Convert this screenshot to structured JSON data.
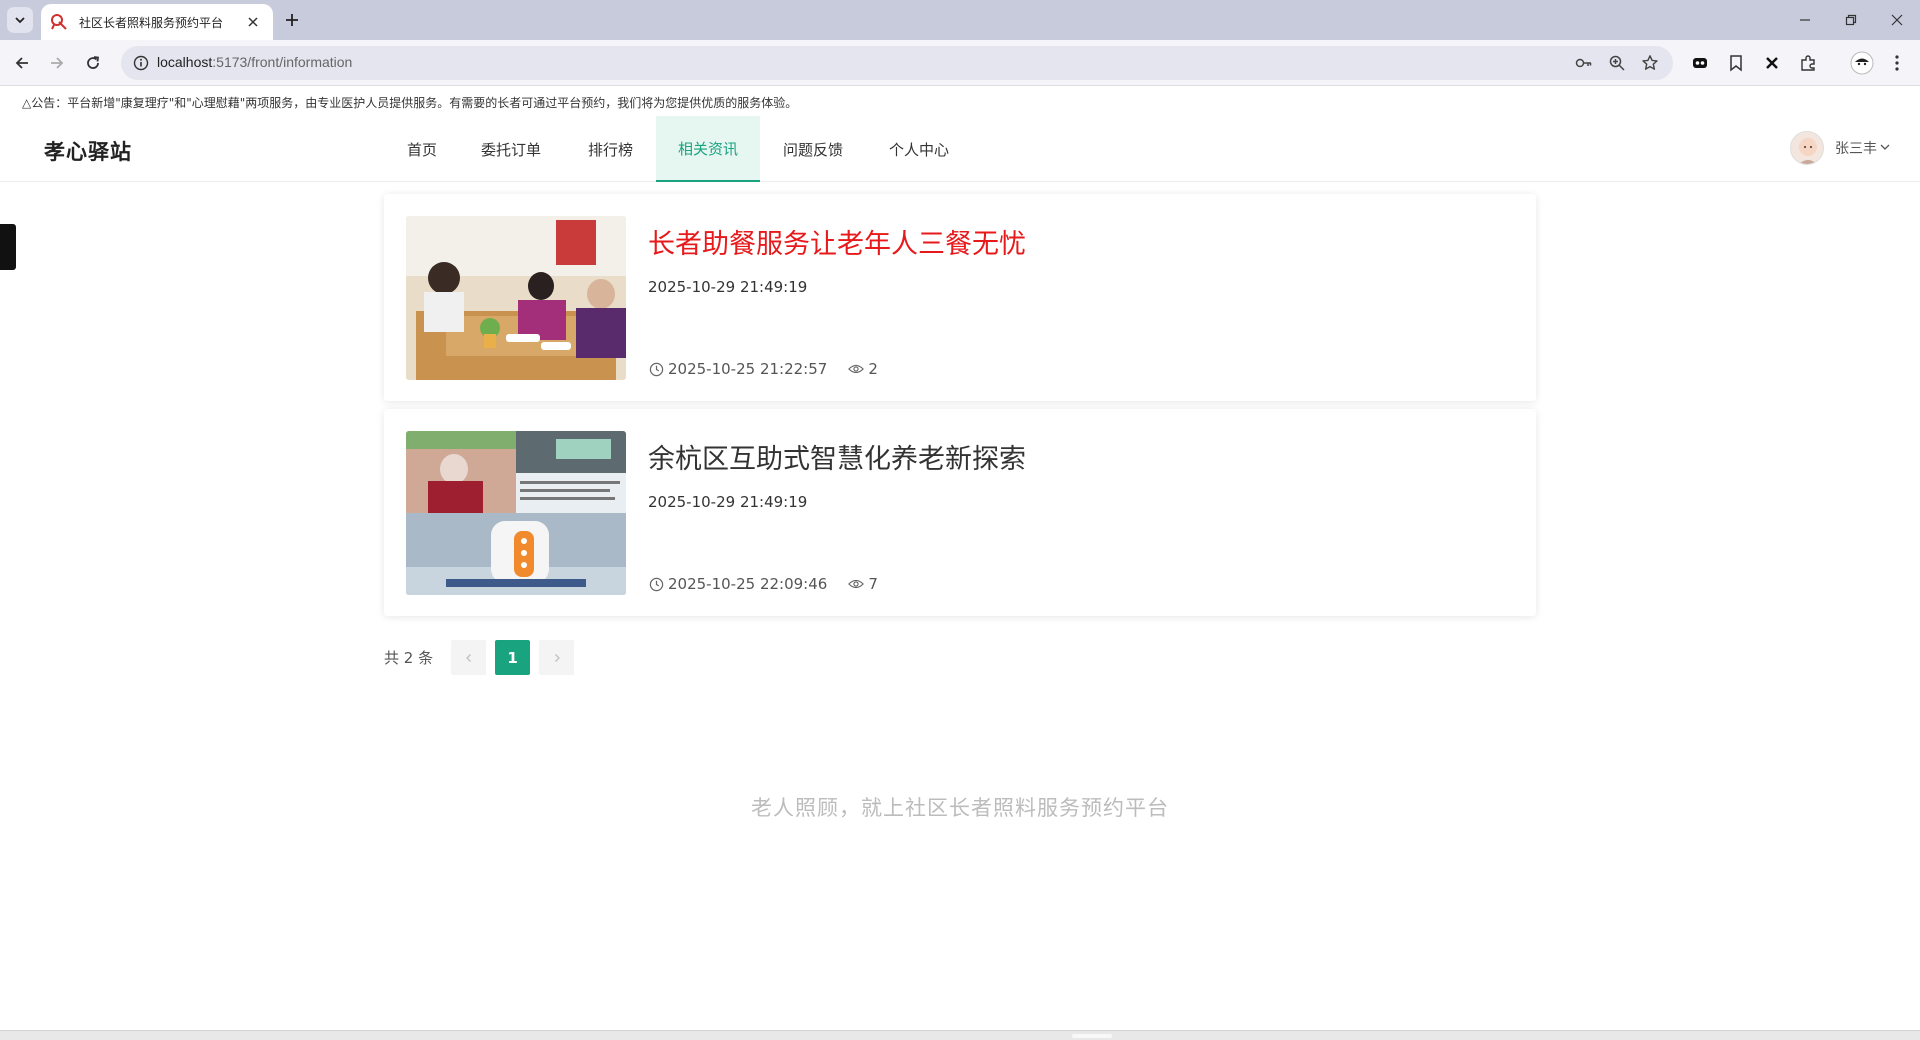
{
  "browser": {
    "tab_title": "社区长者照料服务预约平台",
    "url_host": "localhost",
    "url_path": ":5173/front/information"
  },
  "notice": "△公告：平台新增\"康复理疗\"和\"心理慰藉\"两项服务，由专业医护人员提供服务。有需要的长者可通过平台预约，我们将为您提供优质的服务体验。",
  "brand": "孝心驿站",
  "menu": [
    {
      "label": "首页"
    },
    {
      "label": "委托订单"
    },
    {
      "label": "排行榜"
    },
    {
      "label": "相关资讯",
      "active": true
    },
    {
      "label": "问题反馈"
    },
    {
      "label": "个人中心"
    }
  ],
  "user": {
    "name": "张三丰"
  },
  "articles": [
    {
      "title": "长者助餐服务让老年人三餐无忧",
      "date": "2025-10-29 21:49:19",
      "published": "2025-10-25 21:22:57",
      "views": "2",
      "highlight": true,
      "image_desc": "elderly-dining-photo"
    },
    {
      "title": "余杭区互助式智慧化养老新探索",
      "date": "2025-10-29 21:49:19",
      "published": "2025-10-25 22:09:46",
      "views": "7",
      "highlight": false,
      "image_desc": "smart-elderly-device-collage"
    }
  ],
  "pagination": {
    "total_label": "共 2 条",
    "current": "1"
  },
  "footer": "老人照顾，就上社区长者照料服务预约平台",
  "colors": {
    "accent": "#1aa37f",
    "highlight_title": "#e8191b"
  },
  "icons": [
    "chevron-down-icon",
    "site-favicon-icon",
    "close-icon",
    "plus-icon",
    "back-icon",
    "forward-icon",
    "reload-icon",
    "info-icon",
    "key-icon",
    "zoom-icon",
    "star-icon",
    "extension-icon",
    "bookmark-icon",
    "puzzle-icon",
    "profile-icon",
    "kebab-icon",
    "clock-icon",
    "eye-icon"
  ]
}
